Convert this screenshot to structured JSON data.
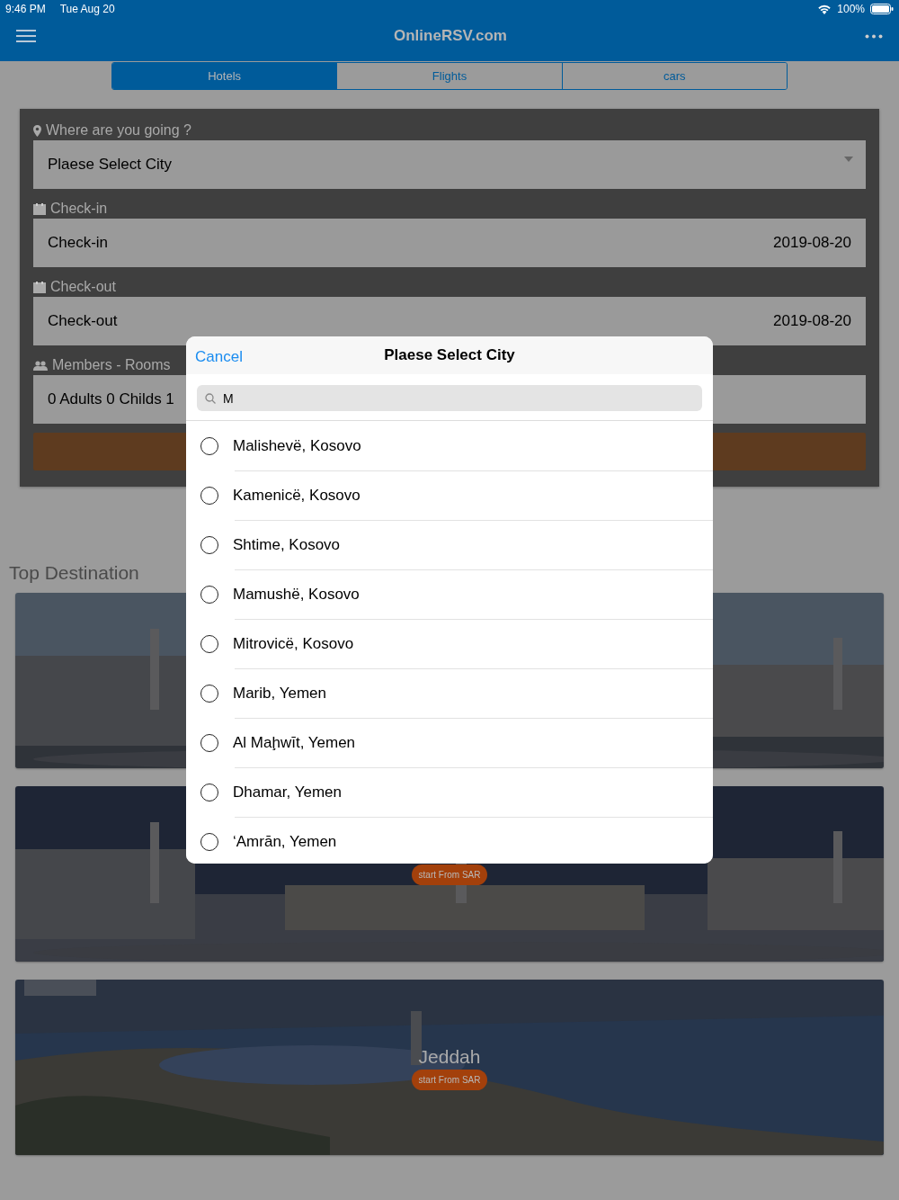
{
  "status_bar": {
    "time": "9:46 PM",
    "date": "Tue Aug 20",
    "battery": "100%"
  },
  "nav": {
    "title": "OnlineRSV.com"
  },
  "tabs": [
    {
      "label": "Hotels",
      "selected": true
    },
    {
      "label": "Flights",
      "selected": false
    },
    {
      "label": "cars",
      "selected": false
    }
  ],
  "form": {
    "fields": [
      {
        "kind": "location",
        "label": "Where are you going ?",
        "value": "Plaese Select City"
      },
      {
        "kind": "date",
        "label": "Check-in",
        "value": "Check-in",
        "date": "2019-08-20"
      },
      {
        "kind": "date",
        "label": "Check-out",
        "value": "Check-out",
        "date": "2019-08-20"
      },
      {
        "kind": "members",
        "label": "Members - Rooms",
        "value": "0 Adults 0 Childs 1"
      }
    ]
  },
  "section_title": "Top Destination",
  "destinations": [
    {
      "kind": "picture"
    },
    {
      "kind": "picture",
      "badge": "start From SAR"
    },
    {
      "kind": "picture",
      "name": "Jeddah",
      "badge": "start From SAR"
    }
  ],
  "picker": {
    "cancel": "Cancel",
    "title": "Plaese Select City",
    "search": "M",
    "options": [
      {
        "label": "Malishevë, Kosovo",
        "selected": false
      },
      {
        "label": "Kamenicë, Kosovo",
        "selected": false
      },
      {
        "label": "Shtime, Kosovo",
        "selected": false
      },
      {
        "label": "Mamushë, Kosovo",
        "selected": false
      },
      {
        "label": "Mitrovicë, Kosovo",
        "selected": false
      },
      {
        "label": "Marib, Yemen",
        "selected": false
      },
      {
        "label": "Al Maḩwīt, Yemen",
        "selected": false
      },
      {
        "label": "Dhamar, Yemen",
        "selected": false
      },
      {
        "label": "‘Amrān, Yemen",
        "selected": false
      }
    ]
  }
}
